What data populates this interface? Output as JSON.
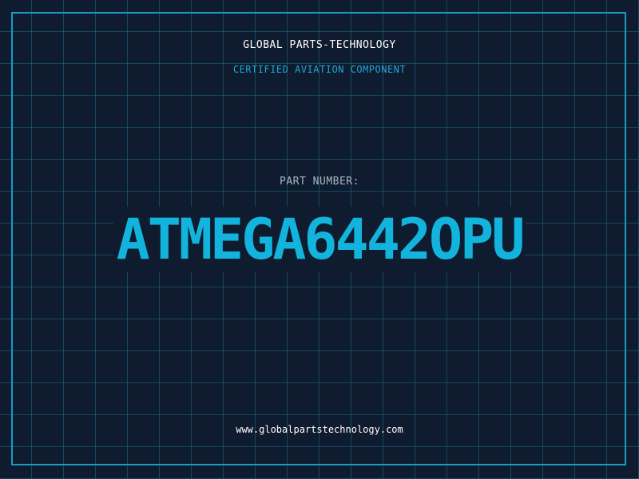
{
  "header": {
    "company": "GLOBAL PARTS-TECHNOLOGY",
    "subtitle": "CERTIFIED AVIATION COMPONENT"
  },
  "part": {
    "label": "PART NUMBER:",
    "number": "ATMEGA6442OPU"
  },
  "footer": {
    "website": "www.globalpartstechnology.com"
  },
  "colors": {
    "background": "#0f1b2e",
    "grid": "#1c6e8c",
    "frame": "#1a9bc2",
    "accent": "#12b4dd",
    "text": "#ffffff",
    "muted": "#a6b8c8"
  }
}
